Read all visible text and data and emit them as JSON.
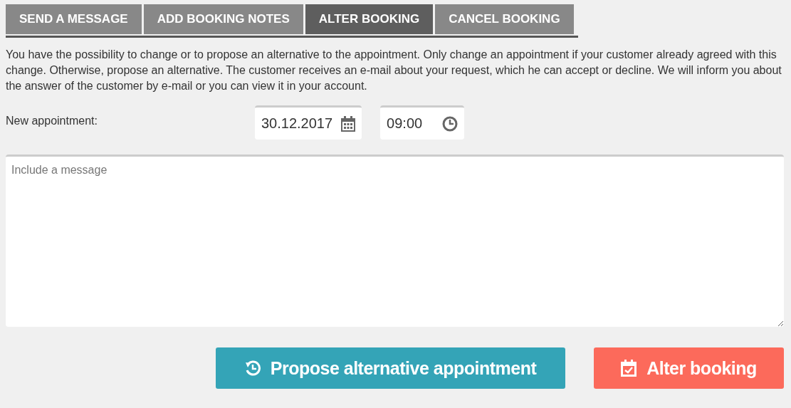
{
  "tabs": [
    {
      "label": "SEND A MESSAGE",
      "selected": false
    },
    {
      "label": "ADD BOOKING NOTES",
      "selected": false
    },
    {
      "label": "ALTER BOOKING",
      "selected": true
    },
    {
      "label": "CANCEL BOOKING",
      "selected": false
    }
  ],
  "description": "You have the possibility to change or to propose an alternative to the appointment. Only change an appointment if your customer already agreed with this change. Otherwise, propose an alternative. The customer receives an e-mail about your request, which he can accept or decline. We will inform you about the answer of the customer by e-mail or you can view it in your account.",
  "appointment": {
    "label": "New appointment:",
    "date": "30.12.2017",
    "time": "09:00"
  },
  "message": {
    "placeholder": "Include a message"
  },
  "buttons": [
    {
      "kind": "propose",
      "label": "Propose alternative appointment"
    },
    {
      "kind": "alter",
      "label": "Alter booking"
    }
  ]
}
